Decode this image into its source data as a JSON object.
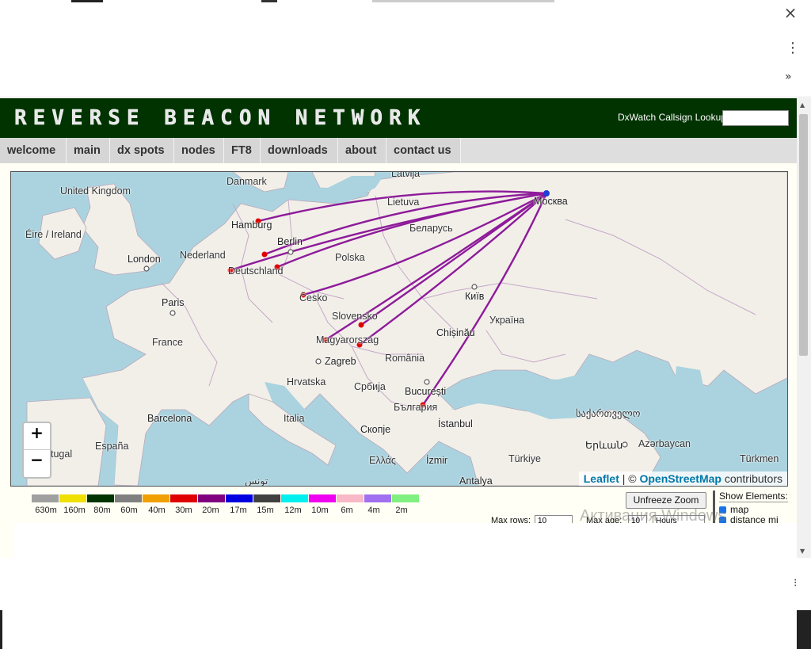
{
  "browser": {
    "close_icon": "×",
    "menu_icon": "⋮",
    "more_icon": "»"
  },
  "header": {
    "logo_text": "REVERSE BEACON NETWORK",
    "lookup_label": "DxWatch Callsign Lookup:",
    "lookup_value": ""
  },
  "nav": {
    "items": [
      "welcome",
      "main",
      "dx spots",
      "nodes",
      "FT8",
      "downloads",
      "about",
      "contact us"
    ]
  },
  "map": {
    "zoom_in": "+",
    "zoom_out": "−",
    "attribution_leaflet": "Leaflet",
    "attribution_sep": " | © ",
    "attribution_osm": "OpenStreetMap",
    "attribution_tail": " contributors",
    "spot_color": "#8e1b9a",
    "origin_color": "#1e3ed6",
    "spotter_color": "#e00000",
    "labels": {
      "uk": "United Kingdom",
      "danmark": "Danmark",
      "latvija": "Latvija",
      "lietuva": "Lietuva",
      "moskva": "Москва",
      "eire": "Éire / Ireland",
      "hamburg": "Hamburg",
      "berlin": "Berlin",
      "belarus": "Беларусь",
      "london": "London",
      "nederland": "Nederland",
      "deutschland": "Deutschland",
      "polska": "Polska",
      "paris": "Paris",
      "cesko": "Česko",
      "kyiv": "Київ",
      "slovensko": "Slovensko",
      "ukraina": "Україна",
      "france": "France",
      "chisinau": "Chișinău",
      "magyarorszag": "Magyarország",
      "zagreb": "Zagreb",
      "romania": "România",
      "hrvatska": "Hrvatska",
      "srbija": "Србија",
      "bucuresti": "București",
      "bulgaria": "България",
      "barcelona": "Barcelona",
      "italia": "Italia",
      "sakartvelo": "საქართველო",
      "skopje": "Скопје",
      "istanbul": "İstanbul",
      "portugal": "tugal",
      "espana": "España",
      "yerevan": "Երևան",
      "azerbaycan": "Azərbaycan",
      "ellas": "Ελλάς",
      "izmir": "İzmir",
      "turkiye": "Türkiye",
      "antalya": "Antalya",
      "turkmen": "Türkmen",
      "tunis": "تونس"
    }
  },
  "legend": {
    "bands": [
      {
        "label": "630m",
        "color": "#a0a0a0"
      },
      {
        "label": "160m",
        "color": "#f0e000"
      },
      {
        "label": "80m",
        "color": "#003300"
      },
      {
        "label": "60m",
        "color": "#808080"
      },
      {
        "label": "40m",
        "color": "#f0a000"
      },
      {
        "label": "30m",
        "color": "#e00000"
      },
      {
        "label": "20m",
        "color": "#800080"
      },
      {
        "label": "17m",
        "color": "#0000e0"
      },
      {
        "label": "15m",
        "color": "#404040"
      },
      {
        "label": "12m",
        "color": "#00f0f0"
      },
      {
        "label": "10m",
        "color": "#f000f0"
      },
      {
        "label": "6m",
        "color": "#f8b8c8"
      },
      {
        "label": "4m",
        "color": "#a070f0"
      },
      {
        "label": "2m",
        "color": "#80f080"
      }
    ]
  },
  "controls": {
    "unfreeze_label": "Unfreeze Zoom",
    "show_title": "Show Elements:",
    "show_map": "map",
    "show_distance": "distance mi",
    "max_rows_label": "Max rows:",
    "max_rows_value": "10",
    "max_age_label": "Max age:",
    "max_age_value": "10",
    "max_age_unit": "Hours",
    "watermark": "Активация Windows"
  }
}
